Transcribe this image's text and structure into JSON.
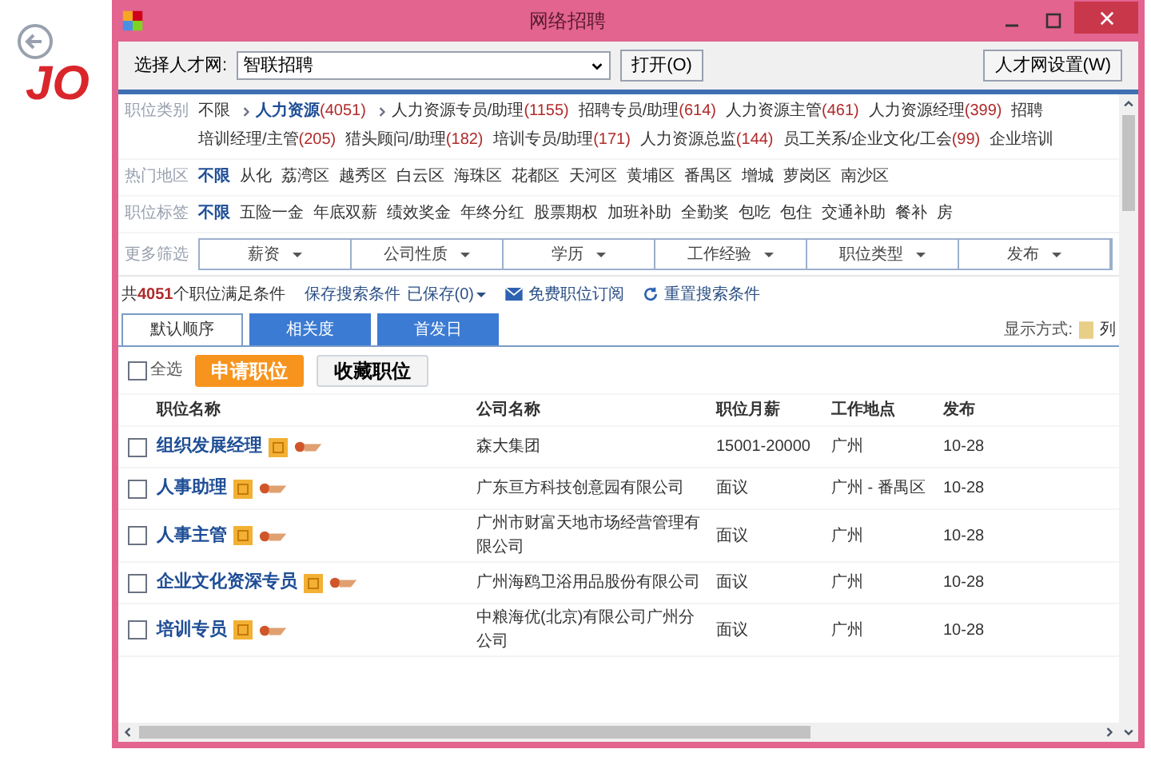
{
  "logo": {
    "text": "JO"
  },
  "window": {
    "title": "网络招聘"
  },
  "toolbar": {
    "label": "选择人才网:",
    "site_select": {
      "value": "智联招聘"
    },
    "open_button": "打开(O)",
    "settings_button": "人才网设置(W)"
  },
  "filters": [
    {
      "label": "职位类别",
      "items": [
        {
          "kind": "option",
          "text": "不限",
          "selected": false
        },
        {
          "kind": "path",
          "text": "人力资源",
          "count": "(4051)",
          "selected": true
        },
        {
          "kind": "path",
          "text": "人力资源专员/助理",
          "count": "(1155)",
          "selected": false
        },
        {
          "kind": "option",
          "text": "招聘专员/助理",
          "count": "(614)",
          "selected": false
        },
        {
          "kind": "option",
          "text": "人力资源主管",
          "count": "(461)",
          "selected": false
        },
        {
          "kind": "option",
          "text": "人力资源经理",
          "count": "(399)",
          "selected": false
        },
        {
          "kind": "option",
          "text": "招聘",
          "selected": false
        },
        {
          "kind": "option",
          "text": "培训经理/主管",
          "count": "(205)",
          "selected": false
        },
        {
          "kind": "option",
          "text": "猎头顾问/助理",
          "count": "(182)",
          "selected": false
        },
        {
          "kind": "option",
          "text": "培训专员/助理",
          "count": "(171)",
          "selected": false
        },
        {
          "kind": "option",
          "text": "人力资源总监",
          "count": "(144)",
          "selected": false
        },
        {
          "kind": "option",
          "text": "员工关系/企业文化/工会",
          "count": "(99)",
          "selected": false
        },
        {
          "kind": "option",
          "text": "企业培训",
          "selected": false
        }
      ]
    },
    {
      "label": "热门地区",
      "items": [
        {
          "kind": "option",
          "text": "不限",
          "selected": true
        },
        {
          "kind": "option",
          "text": "从化",
          "selected": false
        },
        {
          "kind": "option",
          "text": "荔湾区",
          "selected": false
        },
        {
          "kind": "option",
          "text": "越秀区",
          "selected": false
        },
        {
          "kind": "option",
          "text": "白云区",
          "selected": false
        },
        {
          "kind": "option",
          "text": "海珠区",
          "selected": false
        },
        {
          "kind": "option",
          "text": "花都区",
          "selected": false
        },
        {
          "kind": "option",
          "text": "天河区",
          "selected": false
        },
        {
          "kind": "option",
          "text": "黄埔区",
          "selected": false
        },
        {
          "kind": "option",
          "text": "番禺区",
          "selected": false
        },
        {
          "kind": "option",
          "text": "增城",
          "selected": false
        },
        {
          "kind": "option",
          "text": "萝岗区",
          "selected": false
        },
        {
          "kind": "option",
          "text": "南沙区",
          "selected": false
        }
      ]
    },
    {
      "label": "职位标签",
      "items": [
        {
          "kind": "option",
          "text": "不限",
          "selected": true
        },
        {
          "kind": "option",
          "text": "五险一金",
          "selected": false
        },
        {
          "kind": "option",
          "text": "年底双薪",
          "selected": false
        },
        {
          "kind": "option",
          "text": "绩效奖金",
          "selected": false
        },
        {
          "kind": "option",
          "text": "年终分红",
          "selected": false
        },
        {
          "kind": "option",
          "text": "股票期权",
          "selected": false
        },
        {
          "kind": "option",
          "text": "加班补助",
          "selected": false
        },
        {
          "kind": "option",
          "text": "全勤奖",
          "selected": false
        },
        {
          "kind": "option",
          "text": "包吃",
          "selected": false
        },
        {
          "kind": "option",
          "text": "包住",
          "selected": false
        },
        {
          "kind": "option",
          "text": "交通补助",
          "selected": false
        },
        {
          "kind": "option",
          "text": "餐补",
          "selected": false
        },
        {
          "kind": "option",
          "text": "房",
          "selected": false
        }
      ]
    }
  ],
  "more_filters": {
    "label": "更多筛选",
    "dropdowns": [
      "薪资",
      "公司性质",
      "学历",
      "工作经验",
      "职位类型",
      "发布"
    ]
  },
  "summary": {
    "text": "共**4051**个职位满足条件",
    "save_link": "保存搜索条件",
    "saved_link": "已保存(0)",
    "subscribe_link": "免费职位订阅",
    "reset_link": "重置搜索条件"
  },
  "sort_tabs": [
    {
      "label": "默认顺序",
      "selected": true
    },
    {
      "label": "相关度",
      "selected": false
    },
    {
      "label": "首发日",
      "selected": false
    }
  ],
  "display_mode": {
    "label": "显示方式:",
    "option": "列"
  },
  "actions": {
    "select_all": {
      "label": "全选",
      "checked": false
    },
    "apply_button": "申请职位",
    "favorite_button": "收藏职位"
  },
  "table": {
    "columns": [
      "职位名称",
      "公司名称",
      "职位月薪",
      "工作地点",
      "发布"
    ],
    "rows": [
      {
        "checked": false,
        "title": "组织发展经理",
        "company": "森大集团",
        "salary": "15001-20000",
        "location": "广州",
        "date": "10-28"
      },
      {
        "checked": false,
        "title": "人事助理",
        "company": "广东亘方科技创意园有限公司",
        "salary": "面议",
        "location": "广州 - 番禺区",
        "date": "10-28"
      },
      {
        "checked": false,
        "title": "人事主管",
        "company": "广州市财富天地市场经营管理有限公司",
        "salary": "面议",
        "location": "广州",
        "date": "10-28"
      },
      {
        "checked": false,
        "title": "企业文化资深专员",
        "company": "广州海鸥卫浴用品股份有限公司",
        "salary": "面议",
        "location": "广州",
        "date": "10-28"
      },
      {
        "checked": false,
        "title": "培训专员",
        "company": "中粮海优(北京)有限公司广州分公司",
        "salary": "面议",
        "location": "广州",
        "date": "10-28"
      }
    ]
  }
}
